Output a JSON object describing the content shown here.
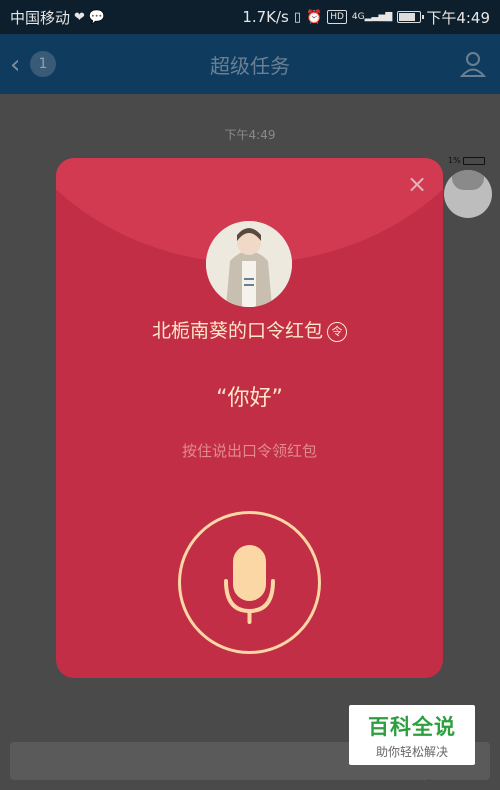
{
  "status_bar": {
    "carrier": "中国移动",
    "network_speed": "1.7K/s",
    "time": "下午4:49",
    "signal_label": "4G"
  },
  "header": {
    "title": "超级任务",
    "back_count": "1"
  },
  "chat": {
    "timestamp": "下午4:49",
    "mini_battery_label": "1%"
  },
  "red_packet": {
    "sender_name": "北栀南葵的口令红包",
    "ling_badge": "令",
    "passphrase": "“你好”",
    "hint": "按住说出口令领红包",
    "close_label": "×"
  },
  "watermark": {
    "main": "百科全说",
    "sub": "助你轻松解决"
  },
  "colors": {
    "packet_red": "#c12e46",
    "gold": "#fbd7a6",
    "header_blue": "#0f3c5e"
  }
}
